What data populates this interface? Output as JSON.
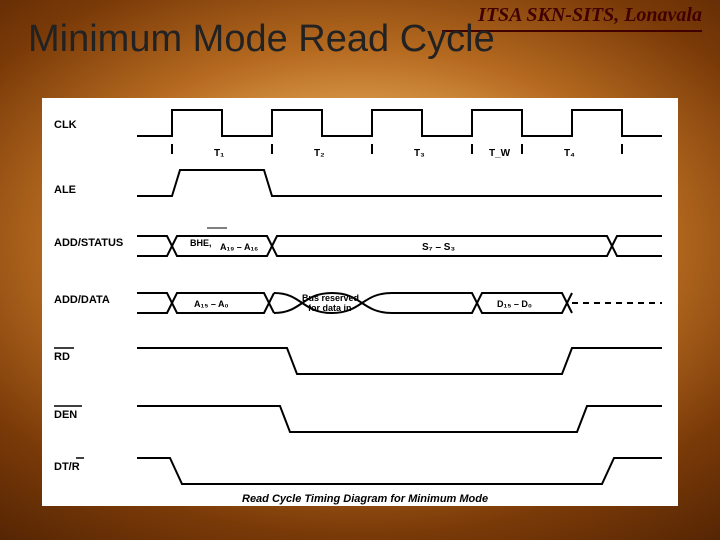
{
  "org": "ITSA SKN-SITS, Lonavala",
  "title": "Minimum Mode Read Cycle",
  "signals": {
    "clk": "CLK",
    "ale": "ALE",
    "addstatus": "ADD/STATUS",
    "adddata": "ADD/DATA",
    "rd": "RD",
    "den": "DEN",
    "dtr": "DT/R"
  },
  "cycle_labels": {
    "t1": "T₁",
    "t2": "T₂",
    "t3": "T₃",
    "tw": "T_W",
    "t4": "T₄"
  },
  "bus_labels": {
    "bhe": "BHE,",
    "a19a16": "A₁₉ – A₁₆",
    "s7s3": "S₇ – S₃",
    "a15a0": "A₁₅ – A₀",
    "busres": "Bus reserved",
    "busres2": "for data in",
    "d15d0": "D₁₅ – D₀"
  },
  "caption": "Read Cycle Timing Diagram for Minimum Mode"
}
